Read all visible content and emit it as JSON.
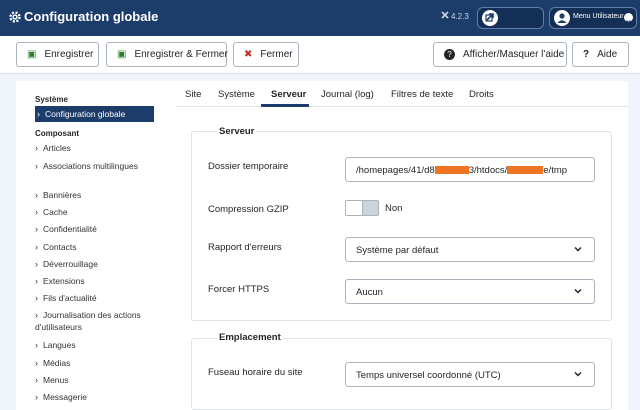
{
  "header": {
    "title": "Configuration globale",
    "version": "4.2.3",
    "user_menu_label": "Menu Utilisateur",
    "bg_color": "#1c3d6a"
  },
  "toolbar": {
    "save_label": "Enregistrer",
    "save_close_label": "Enregistrer & Fermer",
    "close_label": "Fermer",
    "toggle_help_label": "Afficher/Masquer l'aide",
    "help_label": "Aide"
  },
  "sidebar": {
    "section_system": "Système",
    "active_item": "Configuration globale",
    "section_component": "Composant",
    "items": [
      "Articles",
      "Associations multilingues",
      "Bannières",
      "Cache",
      "Confidentialité",
      "Contacts",
      "Déverrouillage",
      "Extensions",
      "Fils d'actualité",
      "Journalisation des actions d'utilisateurs",
      "Langues",
      "Médias",
      "Menus",
      "Messagerie"
    ]
  },
  "tabs": [
    "Site",
    "Système",
    "Serveur",
    "Journal (log)",
    "Filtres de texte",
    "Droits"
  ],
  "active_tab": "Serveur",
  "server": {
    "legend": "Serveur",
    "temp_folder_label": "Dossier temporaire",
    "temp_folder_value_part1": "/homepages/41/d8",
    "temp_folder_value_part2": "3/htdocs/",
    "temp_folder_value_part3": "e/tmp",
    "gzip_label": "Compression GZIP",
    "gzip_value": "Non",
    "error_report_label": "Rapport d'erreurs",
    "error_report_value": "Système par défaut",
    "force_https_label": "Forcer HTTPS",
    "force_https_value": "Aucun"
  },
  "location": {
    "legend": "Emplacement",
    "timezone_label": "Fuseau horaire du site",
    "timezone_value": "Temps universel coordonné (UTC)"
  }
}
